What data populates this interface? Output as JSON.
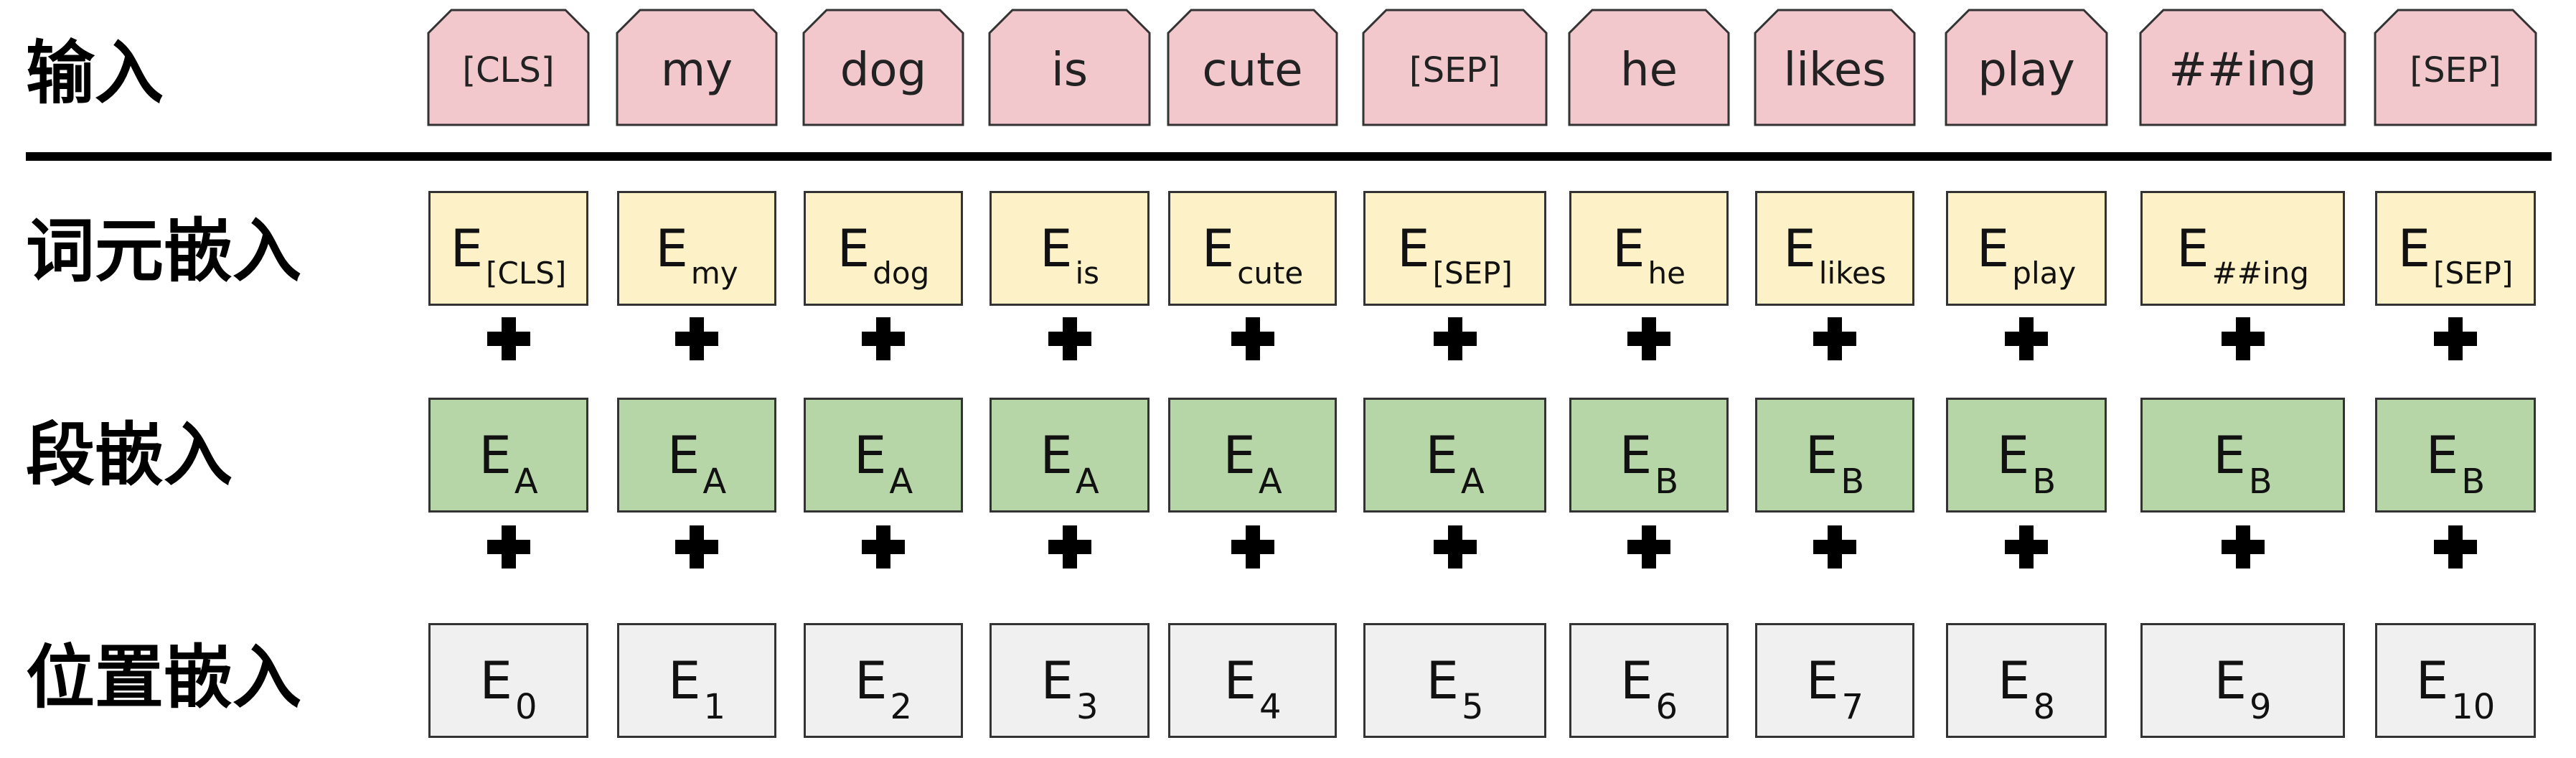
{
  "rows": {
    "input_label": "输入",
    "token_label": "词元嵌入",
    "segment_label": "段嵌入",
    "position_label": "位置嵌入"
  },
  "tokens": [
    "[CLS]",
    "my",
    "dog",
    "is",
    "cute",
    "[SEP]",
    "he",
    "likes",
    "play",
    "##ing",
    "[SEP]"
  ],
  "token_embeddings": {
    "prefix": "E",
    "subs": [
      "[CLS]",
      "my",
      "dog",
      "is",
      "cute",
      "[SEP]",
      "he",
      "likes",
      "play",
      "##ing",
      "[SEP]"
    ]
  },
  "segment_embeddings": {
    "prefix": "E",
    "subs": [
      "A",
      "A",
      "A",
      "A",
      "A",
      "A",
      "B",
      "B",
      "B",
      "B",
      "B"
    ]
  },
  "position_embeddings": {
    "prefix": "E",
    "subs": [
      "0",
      "1",
      "2",
      "3",
      "4",
      "5",
      "6",
      "7",
      "8",
      "9",
      "10"
    ]
  },
  "colors": {
    "input": "#f2c8cc",
    "token_embedding": "#fdf1c8",
    "segment_embedding": "#b7d6a7",
    "position_embedding": "#f0f0f0"
  },
  "operator": "+"
}
